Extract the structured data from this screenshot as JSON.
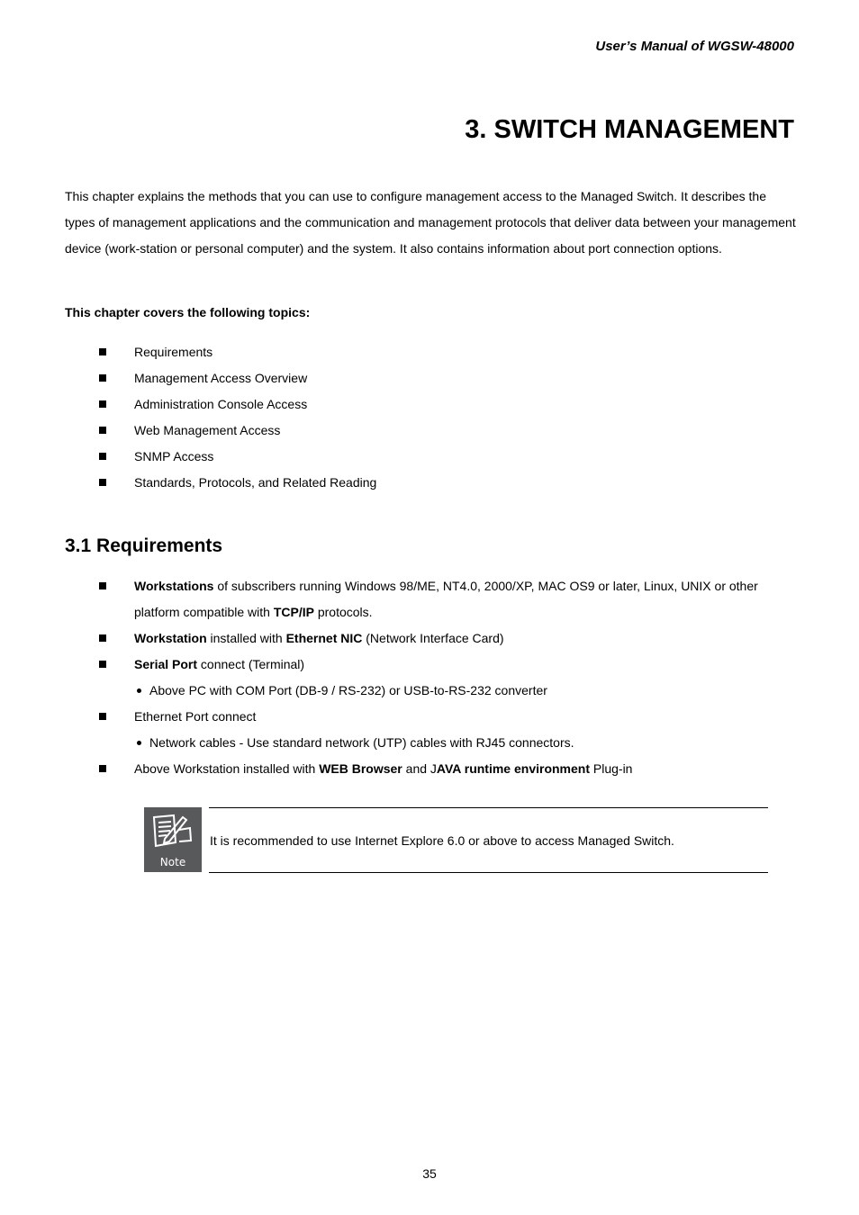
{
  "header": {
    "manual_title": "User’s Manual of WGSW-48000"
  },
  "chapter": {
    "title": "3. SWITCH MANAGEMENT",
    "intro": "This chapter explains the methods that you can use to configure management access to the Managed Switch. It describes the types of management applications and the communication and management protocols that deliver data between your management device (work-station or personal computer) and the system. It also contains information about port connection options.",
    "topics_heading": "This chapter covers the following topics:",
    "topics": [
      "Requirements",
      "Management Access Overview",
      "Administration Console Access",
      "Web Management Access",
      "SNMP Access",
      "Standards, Protocols, and Related Reading"
    ]
  },
  "section": {
    "title": "3.1 Requirements",
    "items": [
      {
        "bold1": "Workstations",
        "text1": " of subscribers running Windows 98/ME, NT4.0, 2000/XP, MAC OS9 or later, Linux, UNIX or other platform compatible with ",
        "bold2": "TCP/IP",
        "text2": " protocols."
      },
      {
        "bold1": "Workstation",
        "text1": " installed with ",
        "bold2": "Ethernet NIC",
        "text2": " (Network Interface Card)"
      },
      {
        "bold1": "Serial Port",
        "text1": " connect (Terminal)",
        "sub": "Above PC with COM Port (DB-9 / RS-232) or USB-to-RS-232 converter"
      },
      {
        "text1": "Ethernet Port connect",
        "sub": "Network cables - Use standard network (UTP) cables with RJ45 connectors."
      },
      {
        "text1": "Above Workstation installed with ",
        "bold1": "WEB Browser",
        "text2": " and J",
        "bold2": "AVA runtime environment",
        "text3": " Plug-in"
      }
    ]
  },
  "note": {
    "icon_label": "Note",
    "text": "It is recommended to use Internet Explore 6.0 or above to access Managed Switch."
  },
  "footer": {
    "page_number": "35"
  }
}
